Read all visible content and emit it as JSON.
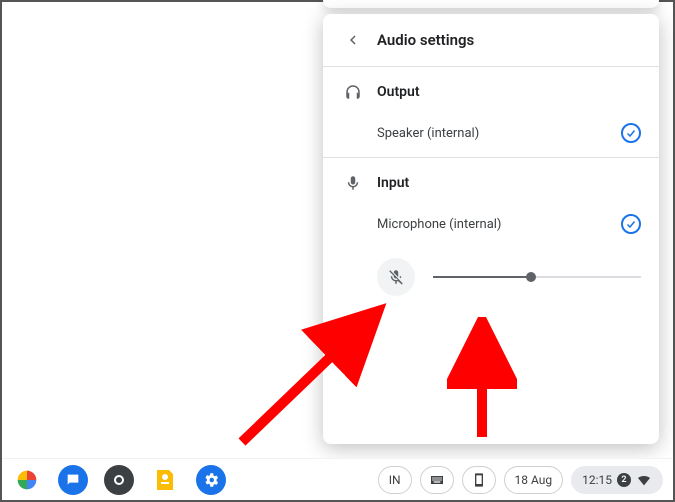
{
  "panel": {
    "title": "Audio settings",
    "output": {
      "section_label": "Output",
      "device": "Speaker (internal)",
      "selected": true
    },
    "input": {
      "section_label": "Input",
      "device": "Microphone (internal)",
      "selected": true,
      "mute_icon": "mic-off-icon",
      "slider_percent": 47
    }
  },
  "shelf": {
    "apps": [
      {
        "name": "photos-icon"
      },
      {
        "name": "messages-icon"
      },
      {
        "name": "circle-app-icon"
      },
      {
        "name": "keep-icon"
      },
      {
        "name": "settings-icon"
      }
    ]
  },
  "status": {
    "ime": "IN",
    "date": "18 Aug",
    "time": "12:15",
    "notification_count": "2"
  }
}
